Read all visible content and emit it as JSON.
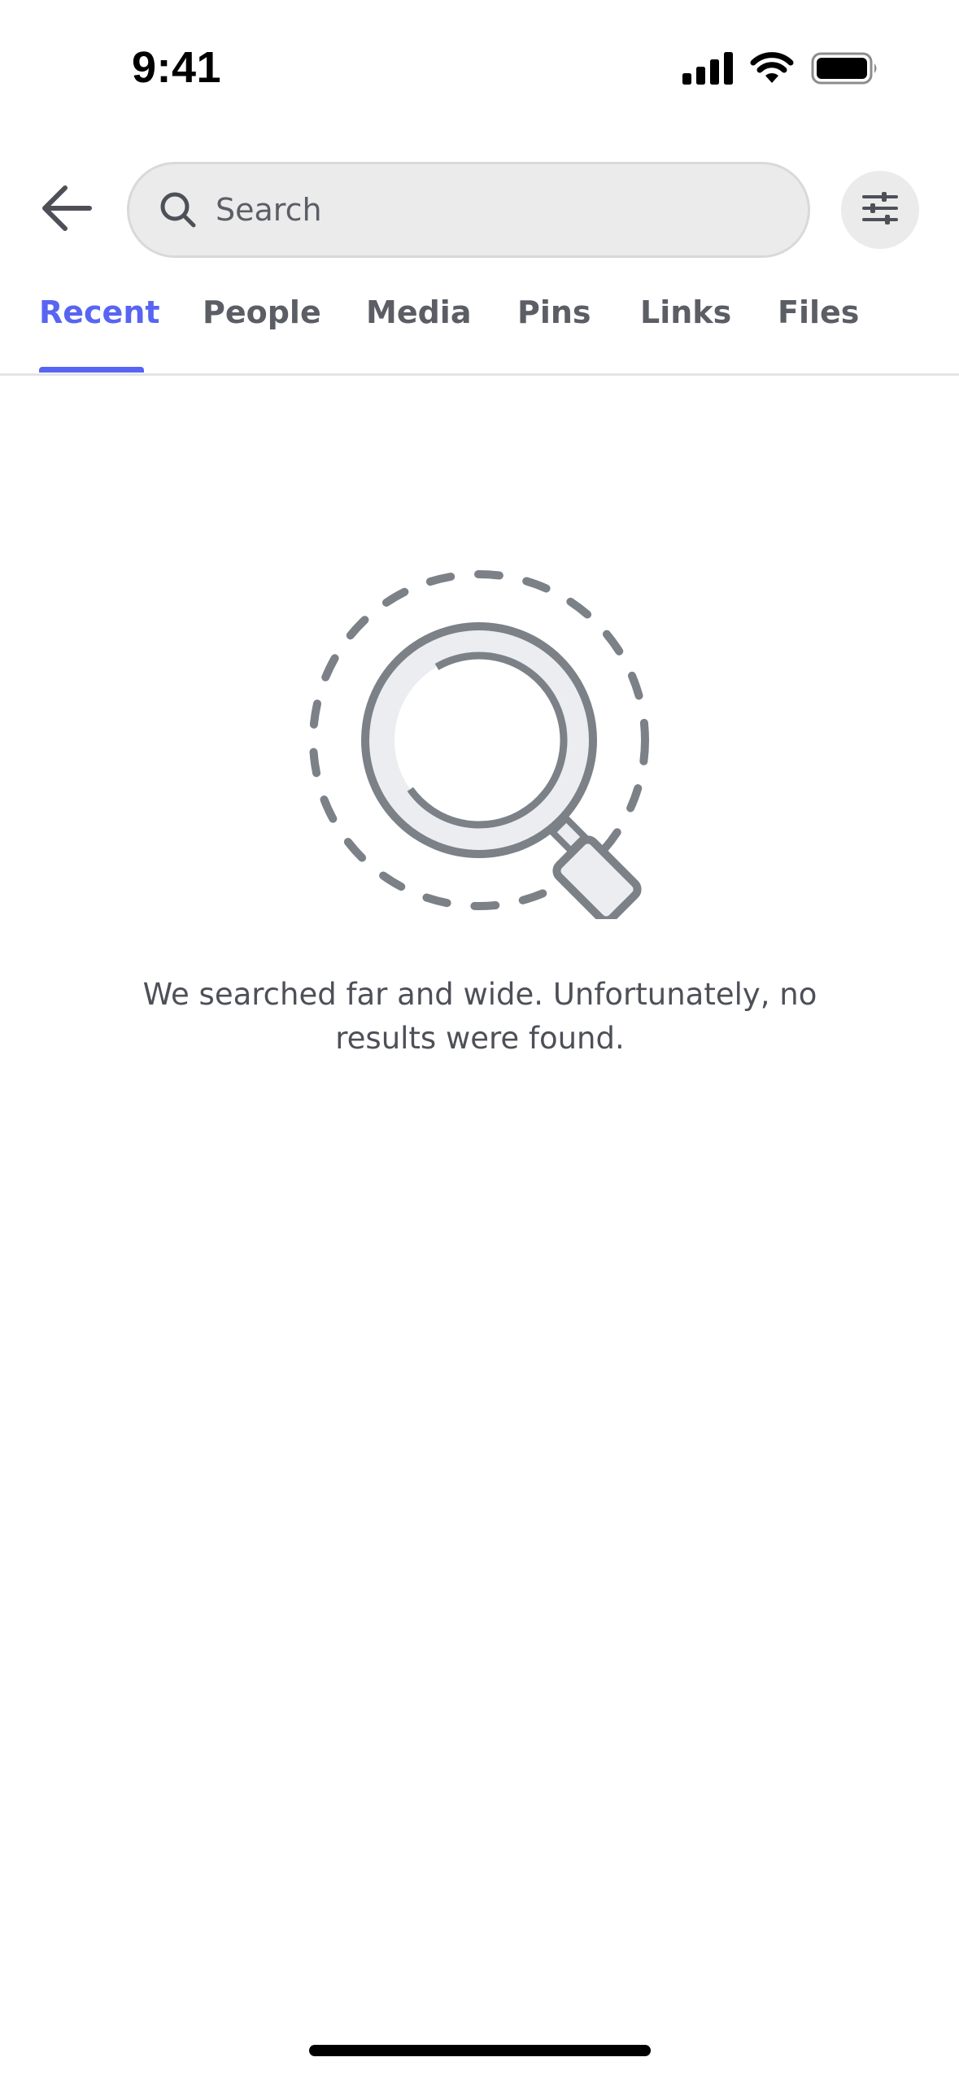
{
  "status_bar": {
    "time": "9:41",
    "icons": [
      "cellular-signal-icon",
      "wifi-icon",
      "battery-icon"
    ]
  },
  "header": {
    "back_icon": "arrow-left-icon",
    "search": {
      "placeholder": "Search",
      "value": "",
      "icon": "search-icon"
    },
    "filter_icon": "sliders-icon"
  },
  "tabs": [
    {
      "label": "Recent",
      "active": true
    },
    {
      "label": "People",
      "active": false
    },
    {
      "label": "Media",
      "active": false
    },
    {
      "label": "Pins",
      "active": false
    },
    {
      "label": "Links",
      "active": false
    },
    {
      "label": "Files",
      "active": false
    }
  ],
  "empty_state": {
    "illustration": "magnifying-glass-icon",
    "line1": "We searched far and wide. Unfortunately, no",
    "line2": "results were found."
  },
  "colors": {
    "accent": "#5865f2",
    "text_muted": "#5c5e66",
    "search_bg": "#ebebeb",
    "illustration_stroke": "#7b8187",
    "illustration_fill": "#ebedf0"
  }
}
